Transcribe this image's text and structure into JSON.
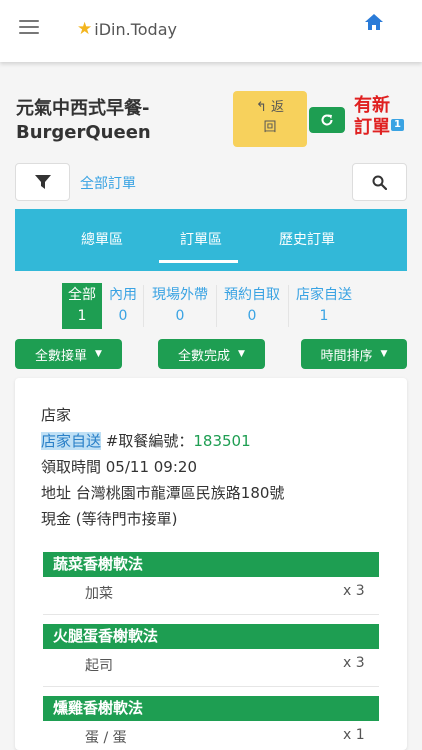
{
  "header": {
    "brand": "iDin.Today"
  },
  "store": {
    "title_line1": "元氣中西式早餐-",
    "title_line2": "BurgerQueen",
    "back_label_1": "返",
    "back_label_2": "回",
    "new_order_line1": "有新",
    "new_order_line2": "訂單",
    "new_order_count": "1"
  },
  "toolbar": {
    "all_orders_link": "全部訂單"
  },
  "tabs": [
    "總單區",
    "訂單區",
    "歷史訂單"
  ],
  "order_types": [
    {
      "label": "全部",
      "count": "1"
    },
    {
      "label": "內用",
      "count": "0"
    },
    {
      "label": "現場外帶",
      "count": "0"
    },
    {
      "label": "預約自取",
      "count": "0"
    },
    {
      "label": "店家自送",
      "count": "1"
    }
  ],
  "actions": {
    "accept_all": "全數接單",
    "complete_all": "全數完成",
    "sort": "時間排序"
  },
  "order": {
    "source": "店家",
    "delivery_type": "店家自送",
    "pickup_code_label": "#取餐編號：",
    "pickup_code": "183501",
    "pickup_time": "領取時間 05/11 09:20",
    "address": "地址 台灣桃園市龍潭區民族路180號",
    "payment": "現金 (等待門市接單)",
    "items": [
      {
        "name": "蔬菜香榭軟法",
        "option": "加菜",
        "qty": "x 3"
      },
      {
        "name": "火腿蛋香榭軟法",
        "option": "起司",
        "qty": "x 3"
      },
      {
        "name": "燻雞香榭軟法",
        "option": "蛋 / 蛋",
        "qty": "x 1"
      }
    ]
  },
  "colors": {
    "green": "#1e9e52",
    "teal": "#32b8d8",
    "yellow": "#f7d15c",
    "red": "#e02020",
    "blue": "#3aa3e3"
  }
}
